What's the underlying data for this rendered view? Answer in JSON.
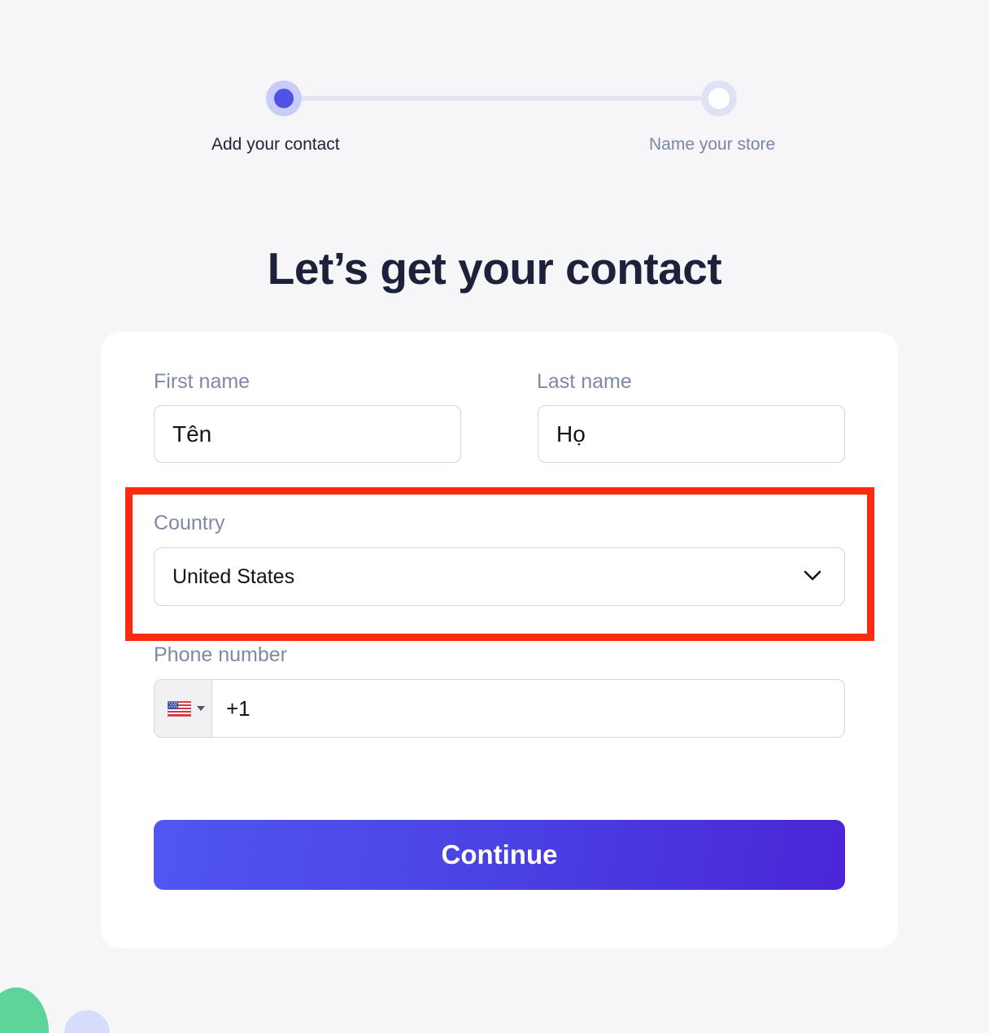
{
  "stepper": {
    "steps": [
      {
        "label": "Add your contact",
        "state": "active"
      },
      {
        "label": "Name your store",
        "state": "upcoming"
      }
    ]
  },
  "heading": "Let’s get your contact",
  "form": {
    "first_name": {
      "label": "First name",
      "value": "Tên"
    },
    "last_name": {
      "label": "Last name",
      "value": "Họ"
    },
    "country": {
      "label": "Country",
      "value": "United States"
    },
    "phone": {
      "label": "Phone number",
      "country_flag": "us-flag-icon",
      "value": "+1"
    },
    "continue_label": "Continue"
  },
  "colors": {
    "accent": "#4f52e6",
    "highlight": "#ff2a0e",
    "title": "#1d2139",
    "label": "#7e89a6"
  }
}
